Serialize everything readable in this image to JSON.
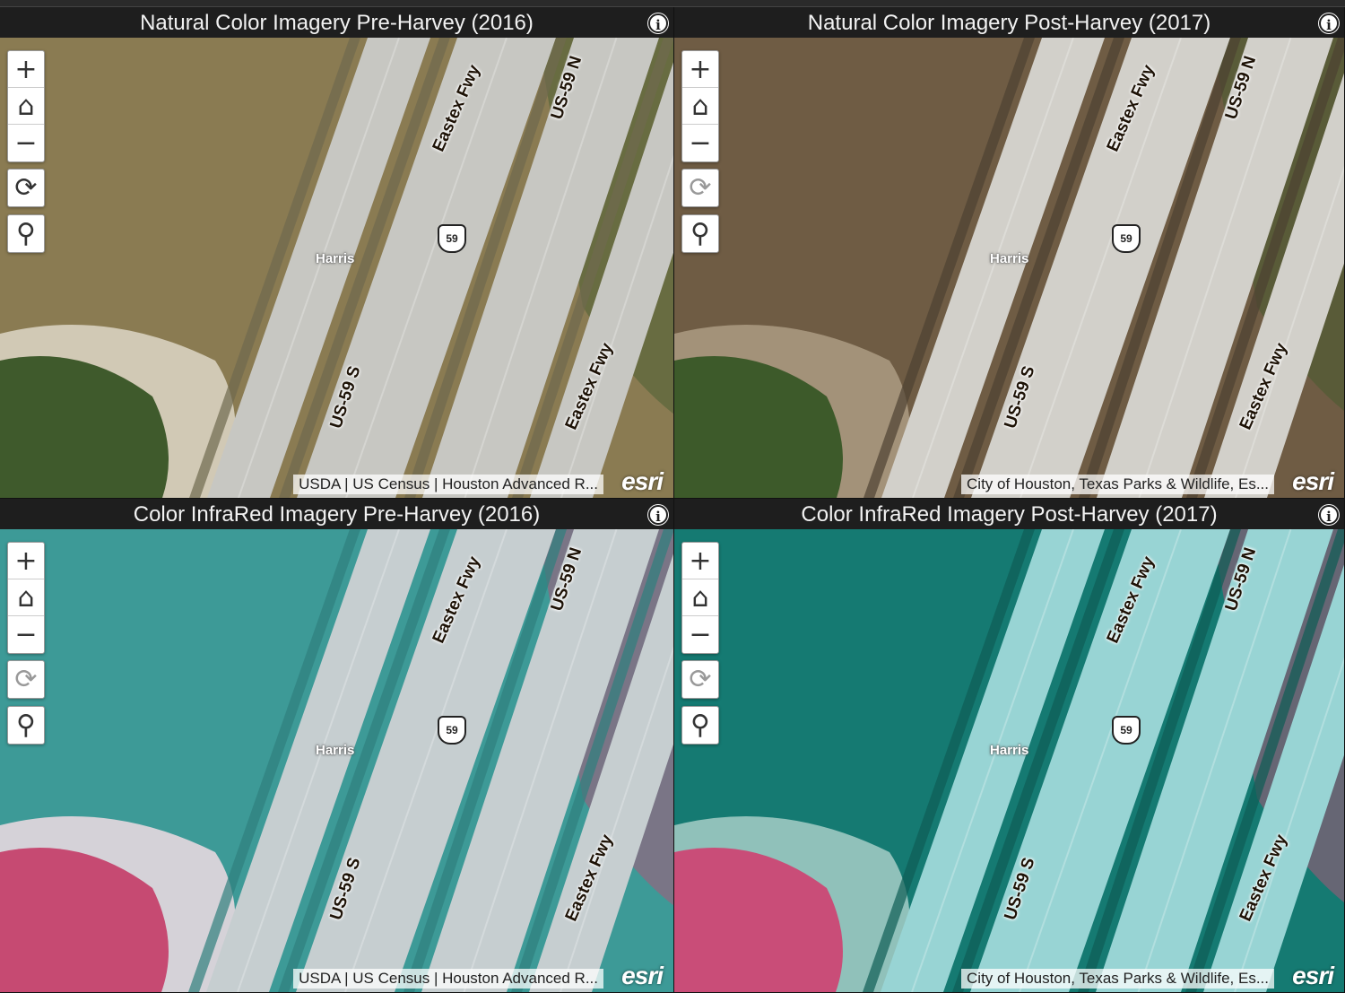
{
  "panes": [
    {
      "title": "Natural Color Imagery Pre-Harvey (2016)",
      "attribution": "USDA | US Census | Houston Advanced R...",
      "theme": {
        "water": "#8a7b52",
        "road": "#c7c7c2",
        "shadow": "#6f6a4e",
        "veg": "#3f5a2c",
        "sand": "#d8d2c0"
      },
      "refresh_active": true
    },
    {
      "title": "Natural Color Imagery Post-Harvey (2017)",
      "attribution": "City of Houston, Texas Parks & Wildlife, Es...",
      "theme": {
        "water": "#6f5c44",
        "road": "#d2d0ca",
        "shadow": "#4d4232",
        "veg": "#3d5a2a",
        "sand": "#a89880"
      },
      "refresh_active": false
    },
    {
      "title": "Color InfraRed Imagery Pre-Harvey (2016)",
      "attribution": "USDA | US Census | Houston Advanced R...",
      "theme": {
        "water": "#3d9a97",
        "road": "#c6ced0",
        "shadow": "#2f7f7d",
        "veg": "#c64a72",
        "sand": "#e6d8df"
      },
      "refresh_active": false
    },
    {
      "title": "Color InfraRed Imagery Post-Harvey (2017)",
      "attribution": "City of Houston, Texas Parks & Wildlife, Es...",
      "theme": {
        "water": "#157a72",
        "road": "#98d4d4",
        "shadow": "#0e5c56",
        "veg": "#c94d78",
        "sand": "#9dc9c2"
      },
      "refresh_active": false
    }
  ],
  "map_labels": {
    "eastex_fwy": "Eastex Fwy",
    "us59_n": "US-59 N",
    "us59_s": "US-59 S",
    "harris": "Harris",
    "shield": "59"
  },
  "controls": {
    "zoom_in": "+",
    "home": "⌂",
    "zoom_out": "−",
    "refresh": "⟳",
    "search": "⚲",
    "info": "i"
  },
  "branding": {
    "logo": "esri"
  }
}
